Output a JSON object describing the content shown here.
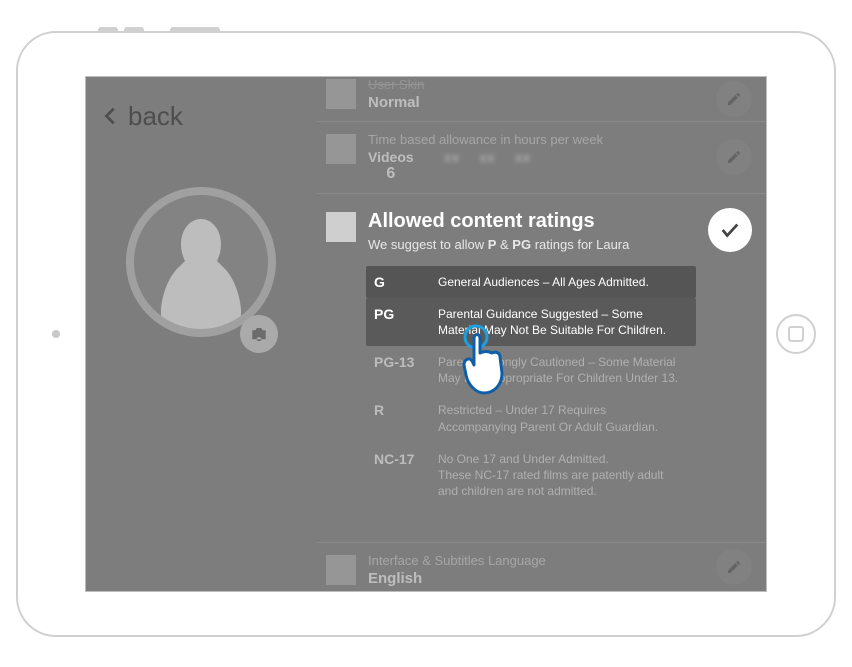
{
  "nav": {
    "back_label": "back"
  },
  "profile": {
    "camera_icon": "camera-icon"
  },
  "rows": {
    "user_skin": {
      "label": "User Skin",
      "value": "Normal"
    },
    "allowance": {
      "label": "Time based allowance in hours per week",
      "videos_label": "Videos",
      "videos_value": "6"
    },
    "language": {
      "label": "Interface & Subtitles Language",
      "value": "English"
    }
  },
  "ratings_section": {
    "title": "Allowed content ratings",
    "suggest_prefix": "We suggest to allow ",
    "suggest_a": "P",
    "suggest_amp": " & ",
    "suggest_b": "PG",
    "suggest_suffix": " ratings for Laura",
    "items": [
      {
        "code": "G",
        "desc": "General Audiences – All Ages Admitted.",
        "selected": true
      },
      {
        "code": "PG",
        "desc": "Parental Guidance Suggested – Some Material May Not Be Suitable For Children.",
        "selected": true
      },
      {
        "code": "PG-13",
        "desc": "Parents Strongly Cautioned – Some Material May Be Inappropriate For Children Under 13.",
        "selected": false
      },
      {
        "code": "R",
        "desc": "Restricted – Under 17 Requires Accompanying Parent Or Adult Guardian.",
        "selected": false
      },
      {
        "code": "NC-17",
        "desc": "No One 17 and Under Admitted.\nThese NC-17 rated films are patently adult and children are not admitted.",
        "selected": false
      }
    ]
  }
}
